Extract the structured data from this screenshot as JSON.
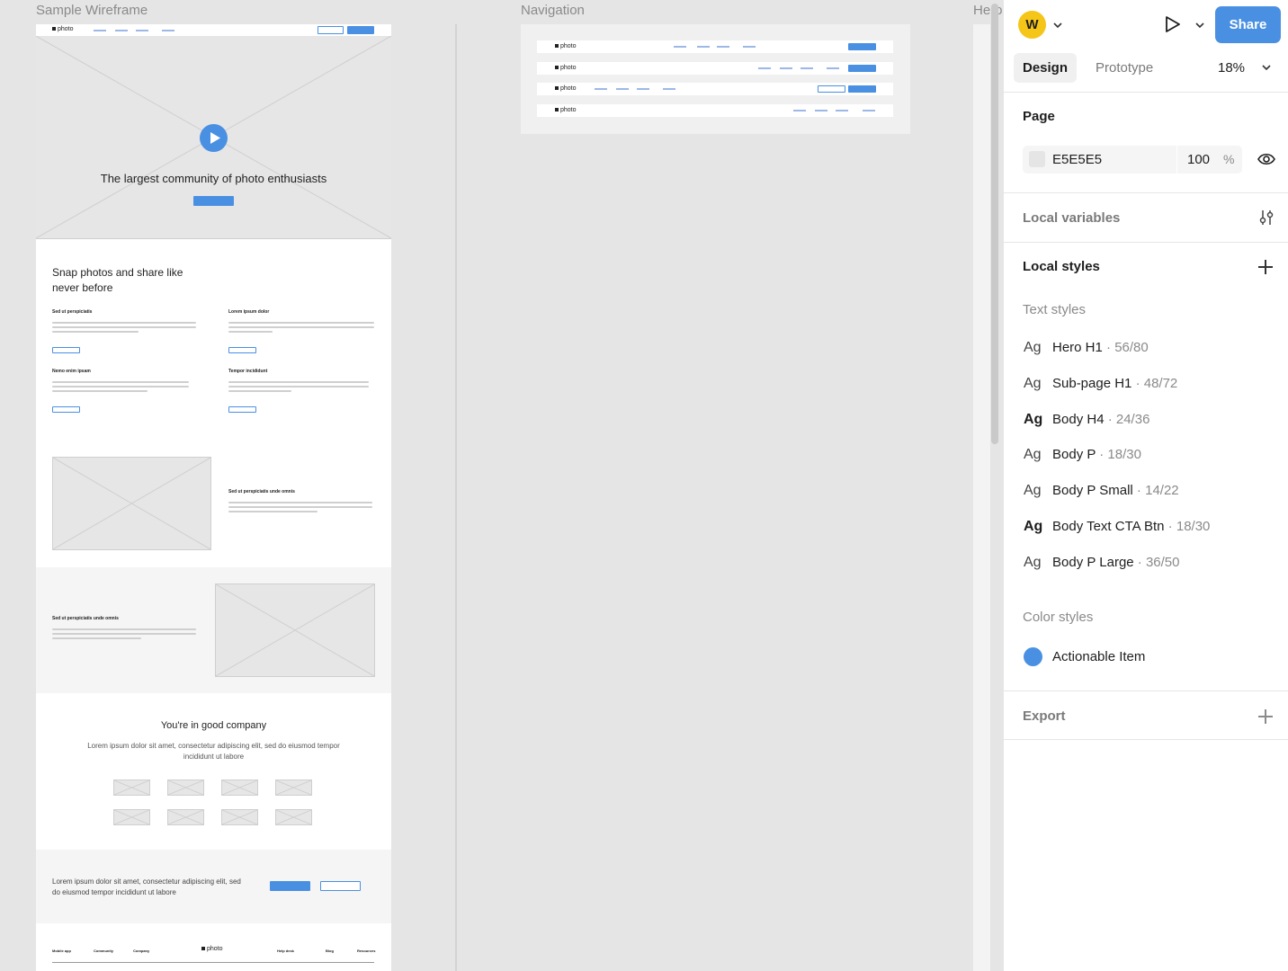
{
  "canvas": {
    "frames": {
      "wireframe_label": "Sample Wireframe",
      "navigation_label": "Navigation",
      "third_label": "Hero"
    },
    "wireframe": {
      "logo": "photo",
      "hero_title": "The largest community of photo enthusiasts",
      "section1_title": "Snap photos and share like never before",
      "features": [
        "Sed ut perspiciatis",
        "Lorem ipsum dolor",
        "Nemo enim ipsam",
        "Tempor incididunt"
      ],
      "split_title_1": "Sed ut perspiciatis unde omnis",
      "split_title_2": "Sed ut perspiciatis unde omnis",
      "company_title": "You're in good company",
      "company_text": "Lorem ipsum dolor sit amet, consectetur adipiscing elit, sed do eiusmod tempor incididunt ut labore",
      "cta_text": "Lorem ipsum dolor sit amet, consectetur adipiscing elit, sed do eiusmod tempor incididunt ut labore",
      "footer_logo": "photo",
      "footer_links": [
        "Mobile app",
        "Community",
        "Company",
        "Help desk",
        "Blog",
        "Resources"
      ]
    },
    "navigation": {
      "logos": [
        "photo",
        "photo",
        "photo",
        "photo"
      ]
    }
  },
  "panel": {
    "avatar_initial": "W",
    "share_label": "Share",
    "tabs": [
      "Design",
      "Prototype"
    ],
    "zoom": "18%",
    "page": {
      "title": "Page",
      "color_hex": "E5E5E5",
      "opacity": "100",
      "percent": "%",
      "swatch_color": "#e5e5e5"
    },
    "local_variables": "Local variables",
    "local_styles": "Local styles",
    "text_styles_title": "Text styles",
    "text_styles": [
      {
        "ag": "Ag",
        "name": "Hero H1",
        "meta": " · 56/80",
        "bold": false
      },
      {
        "ag": "Ag",
        "name": "Sub-page H1",
        "meta": " · 48/72",
        "bold": false
      },
      {
        "ag": "Ag",
        "name": "Body H4",
        "meta": " · 24/36",
        "bold": true
      },
      {
        "ag": "Ag",
        "name": "Body P",
        "meta": " · 18/30",
        "bold": false
      },
      {
        "ag": "Ag",
        "name": "Body P Small",
        "meta": " · 14/22",
        "bold": false
      },
      {
        "ag": "Ag",
        "name": "Body Text CTA Btn",
        "meta": " · 18/30",
        "bold": true
      },
      {
        "ag": "Ag",
        "name": "Body P Large",
        "meta": " · 36/50",
        "bold": false
      }
    ],
    "color_styles_title": "Color styles",
    "color_styles": [
      {
        "name": "Actionable Item",
        "color": "#4a90e2"
      }
    ],
    "export": "Export",
    "colors": {
      "accent": "#4a90e2",
      "share_bg": "#4a90e2",
      "avatar_bg": "#f5c518"
    }
  }
}
